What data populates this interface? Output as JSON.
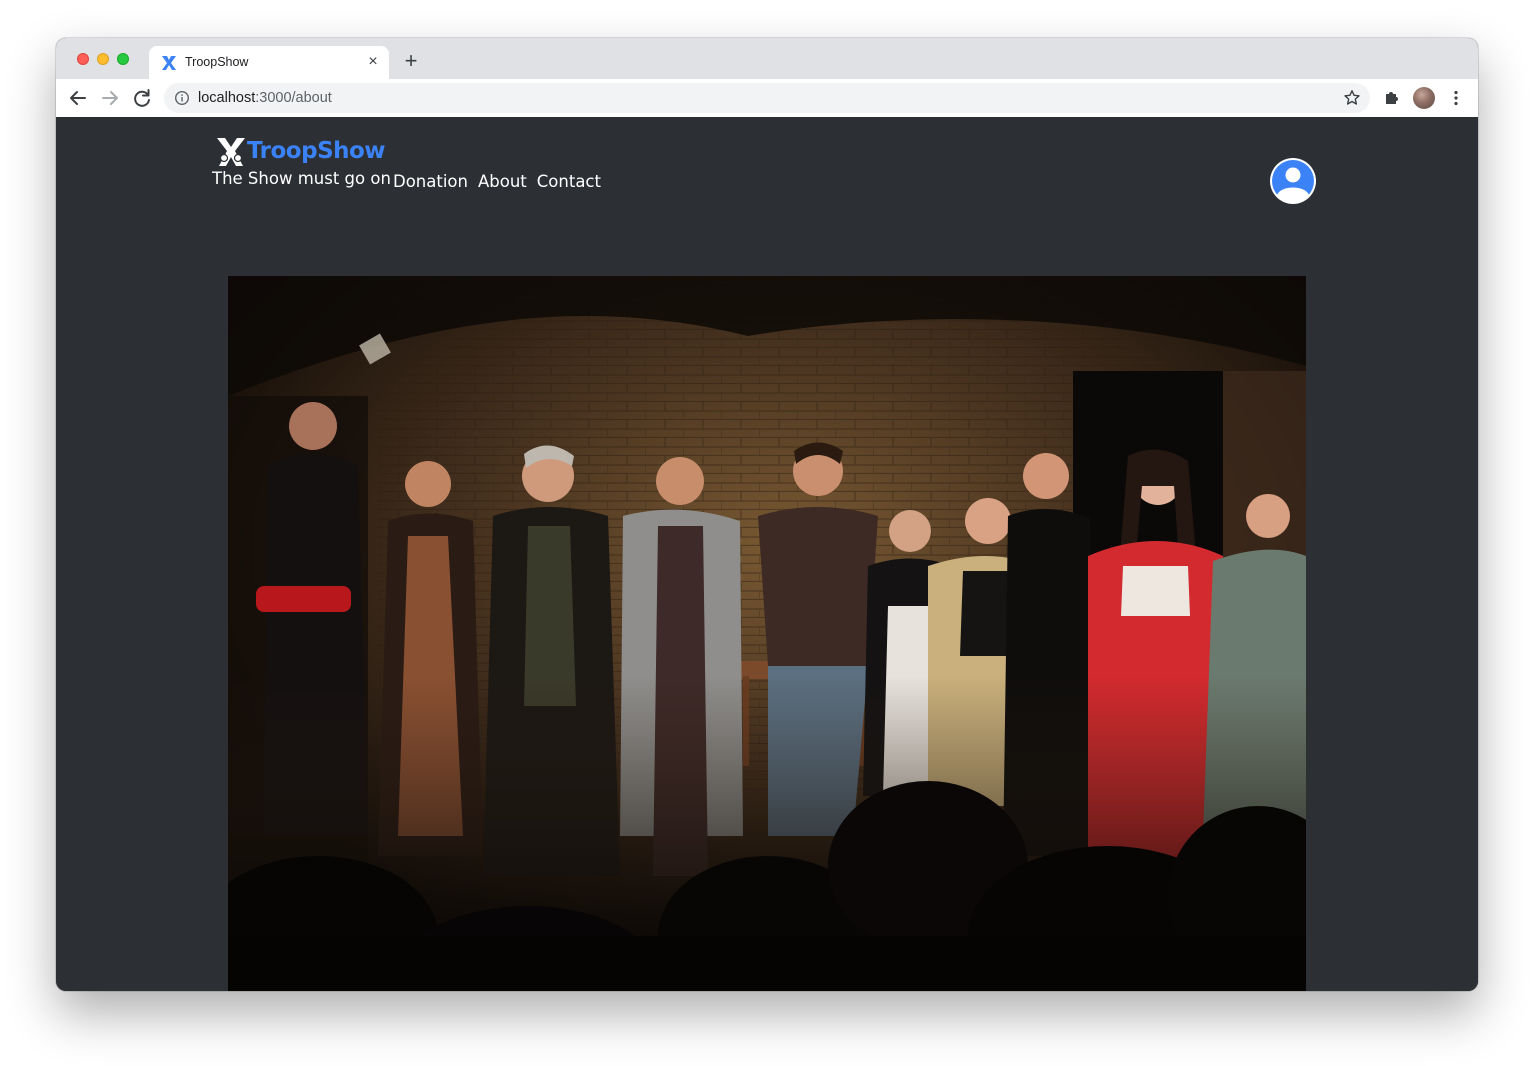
{
  "browser": {
    "tab_title": "TroopShow",
    "tab_close_glyph": "×",
    "new_tab_glyph": "+",
    "url_host": "localhost",
    "url_path": ":3000/about",
    "icons": [
      "back-arrow-icon",
      "forward-arrow-icon",
      "reload-icon",
      "info-icon",
      "star-icon",
      "puzzle-extension-icon",
      "profile-avatar",
      "kebab-menu-icon"
    ]
  },
  "site": {
    "brand_name": "TroopShow",
    "tagline": "The Show must go on",
    "brand_color": "#3b82f6",
    "background_color": "#2c3035",
    "nav": [
      {
        "label": "Donation"
      },
      {
        "label": "About"
      },
      {
        "label": "Contact"
      }
    ],
    "user_icon": "user-avatar-icon",
    "hero_image_icon": "theatre-cast-bow-photo"
  }
}
